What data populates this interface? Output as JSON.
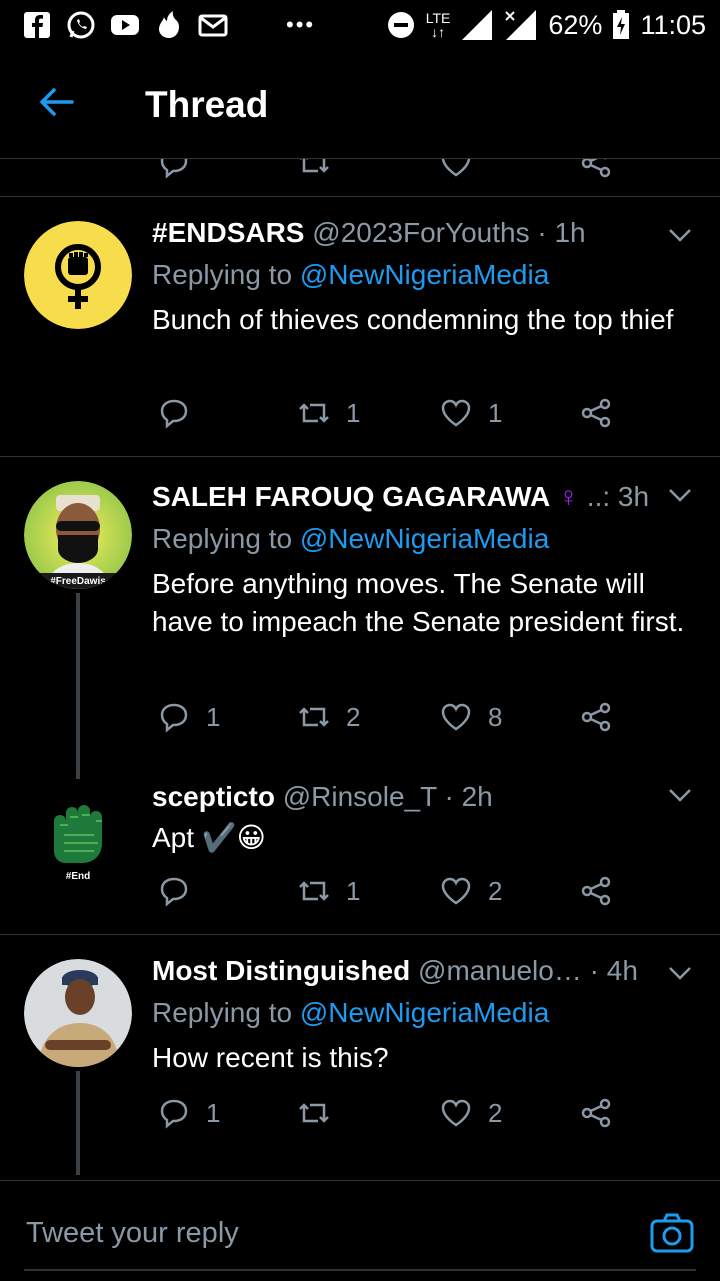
{
  "status_bar": {
    "battery": "62%",
    "time": "11:05",
    "network": "LTE",
    "icons": [
      "facebook-icon",
      "whatsapp-icon",
      "youtube-icon",
      "tinder-icon",
      "gmail-icon",
      "more-dots-icon",
      "dnd-icon",
      "lte-icon",
      "signal-icon",
      "no-signal-icon",
      "battery-charging-icon"
    ]
  },
  "header": {
    "title": "Thread"
  },
  "tweets": [
    {
      "name": "#ENDSARS",
      "handle": "@2023ForYouths",
      "time": "· 1h",
      "replying_prefix": "Replying to",
      "replying_to": "@NewNigeriaMedia",
      "text": "Bunch of thieves condemning the top thief",
      "replies": "",
      "retweets": "1",
      "likes": "1"
    },
    {
      "name": "SALEH FAROUQ GAGARAWA",
      "name_symbol": "♀",
      "handle": "..:",
      "time": "3h",
      "replying_prefix": "Replying to",
      "replying_to": "@NewNigeriaMedia",
      "text": "Before anything moves. The Senate will have to impeach the Senate president first.",
      "replies": "1",
      "retweets": "2",
      "likes": "8",
      "avatar_text": "#FreeDawis"
    },
    {
      "name": "scepticto",
      "handle": "@Rinsole_T",
      "time": "· 2h",
      "text": "Apt ✔️😀",
      "replies": "",
      "retweets": "1",
      "likes": "2",
      "avatar_text": "#End"
    },
    {
      "name": "Most Distinguished",
      "handle": "@manuelo…",
      "time": "· 4h",
      "replying_prefix": "Replying to",
      "replying_to": "@NewNigeriaMedia",
      "text": "How recent is this?",
      "replies": "1",
      "retweets": "",
      "likes": "2"
    }
  ],
  "composer": {
    "placeholder": "Tweet your reply"
  },
  "colors": {
    "accent": "#1d9bf0",
    "muted": "#8b98a5",
    "background": "#000000",
    "divider": "#2f3336"
  }
}
